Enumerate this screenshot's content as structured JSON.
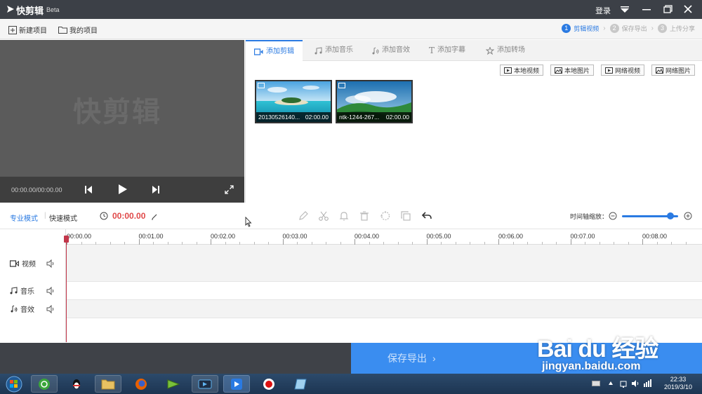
{
  "titlebar": {
    "app_name": "快剪辑",
    "beta": "Beta",
    "login": "登录"
  },
  "project": {
    "new_project": "新建项目",
    "my_projects": "我的项目"
  },
  "steps": [
    {
      "num": "1",
      "label": "剪辑视频",
      "active": true
    },
    {
      "num": "2",
      "label": "保存导出",
      "active": false
    },
    {
      "num": "3",
      "label": "上传分享",
      "active": false
    }
  ],
  "preview": {
    "watermark": "快剪辑",
    "time": "00:00.00/00:00.00"
  },
  "tabs": [
    {
      "label": "添加剪辑",
      "icon": "video-icon",
      "active": true
    },
    {
      "label": "添加音乐",
      "icon": "music-icon",
      "active": false
    },
    {
      "label": "添加音效",
      "icon": "sound-effect-icon",
      "active": false
    },
    {
      "label": "添加字幕",
      "icon": "text-icon",
      "active": false
    },
    {
      "label": "添加转场",
      "icon": "transition-icon",
      "active": false
    }
  ],
  "sources": [
    "本地视频",
    "本地图片",
    "网络视频",
    "网络图片"
  ],
  "clips": [
    {
      "name": "20130526140...",
      "duration": "02:00.00"
    },
    {
      "name": "ntk-1244-267...",
      "duration": "02:00.00"
    }
  ],
  "edit_toolbar": {
    "mode_pro": "专业模式",
    "mode_fast": "快速模式",
    "timecode": "00:00.00",
    "zoom_label": "时间轴缩放：",
    "zoom_level": 0.86
  },
  "ruler": [
    "00:00.00",
    "00:01.00",
    "00:02.00",
    "00:03.00",
    "00:04.00",
    "00:05.00",
    "00:06.00",
    "00:07.00",
    "00:08.00"
  ],
  "tracks": [
    {
      "label": "视频",
      "icon": "video-icon"
    },
    {
      "label": "音乐",
      "icon": "music-icon"
    },
    {
      "label": "音效",
      "icon": "sound-effect-icon"
    }
  ],
  "export_label": "保存导出",
  "taskbar": {
    "time": "22:33",
    "date": "2019/3/10"
  },
  "watermark": {
    "brand": "Bai du 经验",
    "url": "jingyan.baidu.com"
  },
  "colors": {
    "accent": "#2a7ae2",
    "timecode": "#e04848",
    "export": "#3a8df0",
    "titlebar": "#3c4047"
  }
}
